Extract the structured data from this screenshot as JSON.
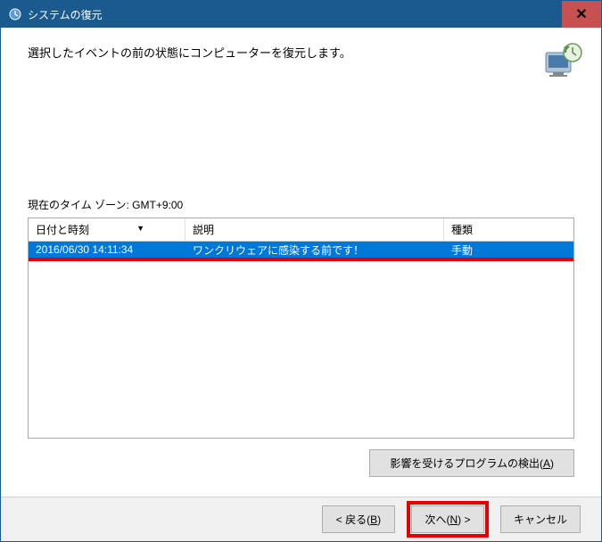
{
  "title": "システムの復元",
  "header_text": "選択したイベントの前の状態にコンピューターを復元します。",
  "timezone_label": "現在のタイム ゾーン: GMT+9:00",
  "columns": {
    "date": "日付と時刻",
    "desc": "説明",
    "type": "種類"
  },
  "rows": [
    {
      "date": "2016/06/30 14:11:34",
      "desc": "ワンクリウェアに感染する前です！",
      "type": "手動"
    }
  ],
  "detect_button": "影響を受けるプログラムの検出(A)",
  "buttons": {
    "back": "< 戻る(B)",
    "next": "次へ(N) >",
    "cancel": "キャンセル"
  },
  "sort_indicator": "▼"
}
